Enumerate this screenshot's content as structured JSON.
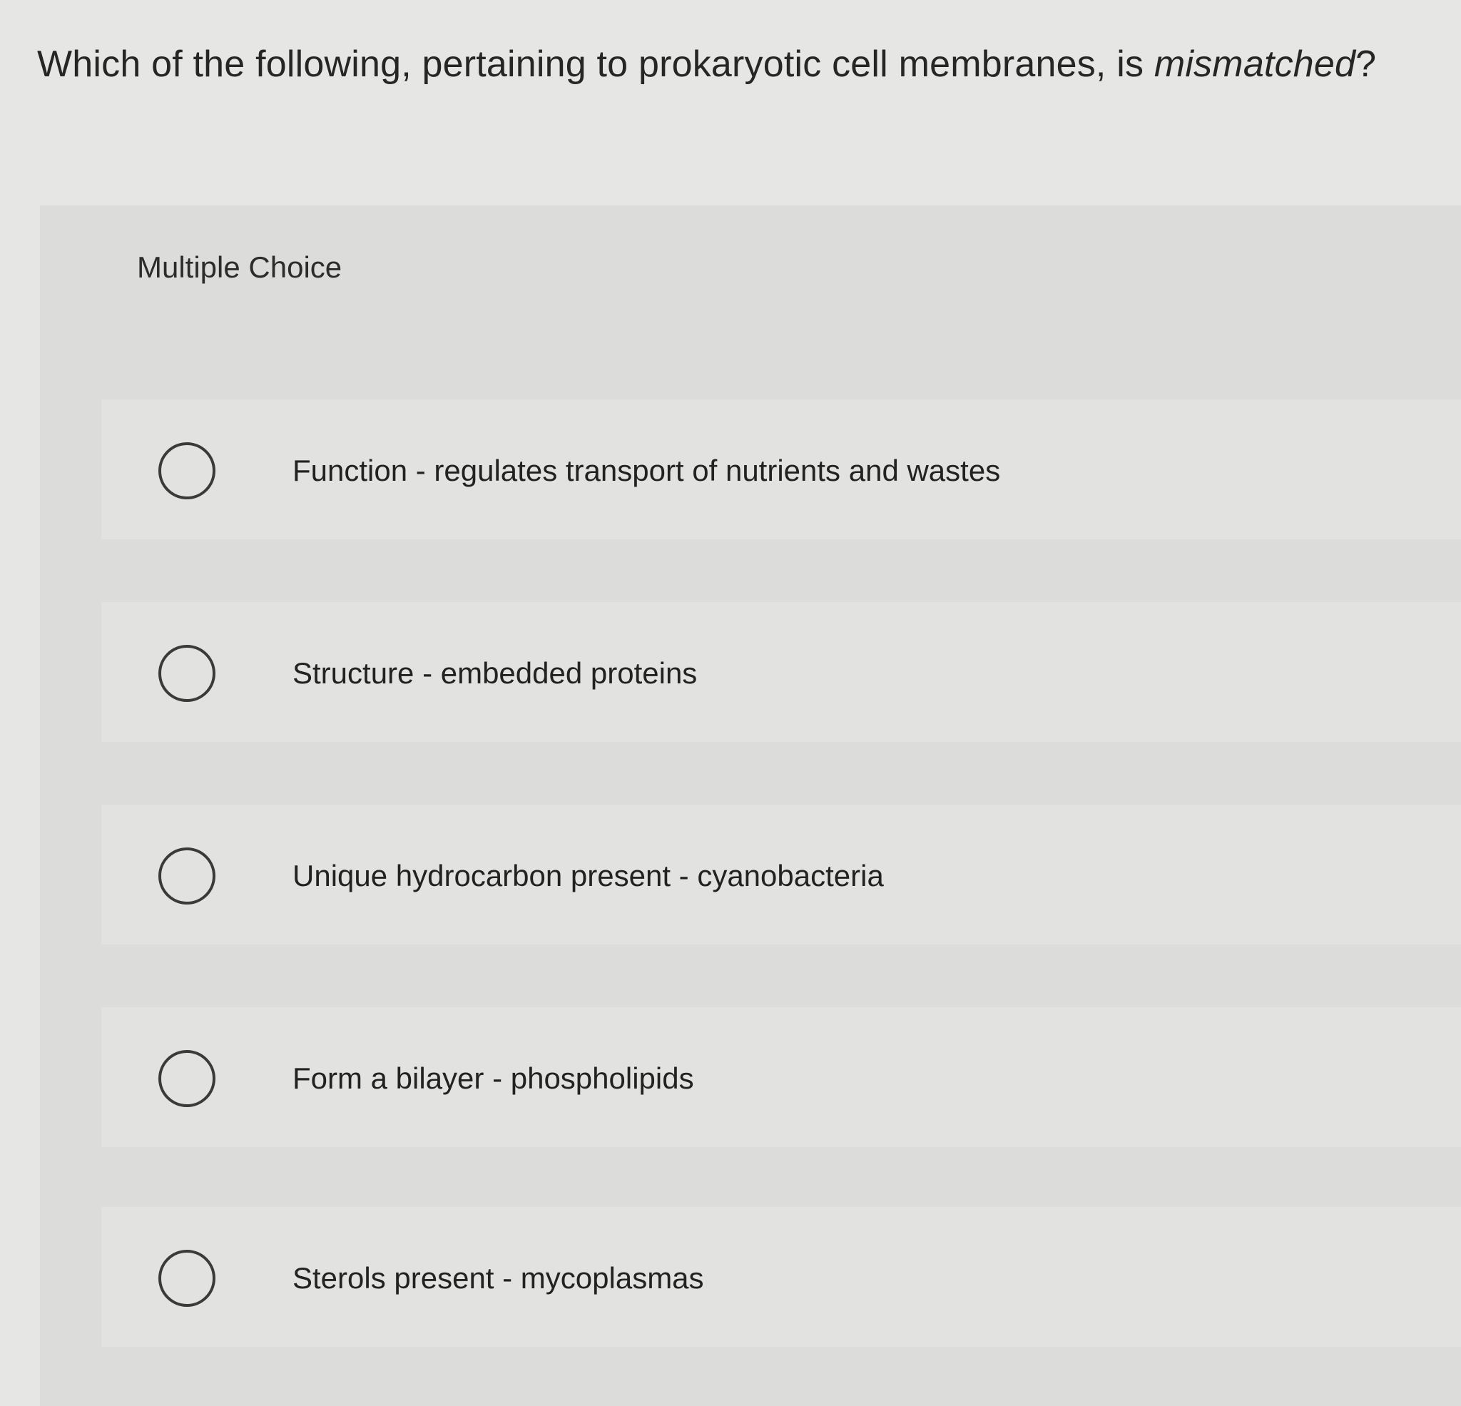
{
  "question": {
    "text_before": "Which of the following, pertaining to prokaryotic cell membranes, is ",
    "text_emphasis": "mismatched",
    "text_after": "?"
  },
  "panel": {
    "title": "Multiple Choice"
  },
  "options": [
    {
      "label": "Function - regulates transport of nutrients and wastes"
    },
    {
      "label": "Structure - embedded proteins"
    },
    {
      "label": "Unique hydrocarbon present - cyanobacteria"
    },
    {
      "label": "Form a bilayer - phospholipids"
    },
    {
      "label": "Sterols present - mycoplasmas"
    }
  ]
}
